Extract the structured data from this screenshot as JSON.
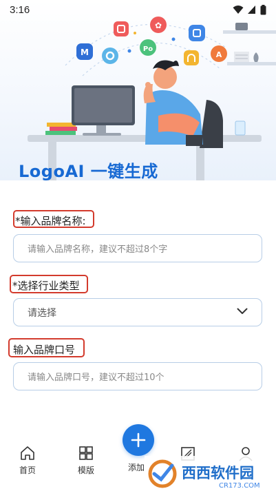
{
  "status_bar": {
    "time": "3:16"
  },
  "hero": {
    "title": "LogoAI  一键生成"
  },
  "form": {
    "brand_name": {
      "label": "*输入品牌名称:",
      "placeholder": "请输入品牌名称，建议不超过8个字"
    },
    "industry": {
      "label": "*选择行业类型",
      "selected": "请选择"
    },
    "slogan": {
      "label": "输入品牌口号",
      "placeholder": "请输入品牌口号，建议不超过10个"
    }
  },
  "bottom_nav": {
    "items": [
      {
        "label": "首页",
        "icon": "home-icon"
      },
      {
        "label": "模版",
        "icon": "grid-icon"
      },
      {
        "label": "添加",
        "icon": "plus-icon"
      },
      {
        "label": "",
        "icon": "image-icon"
      },
      {
        "label": "",
        "icon": "user-icon"
      }
    ]
  },
  "watermark": {
    "brand": "西西软件园",
    "url": "CR173.COM"
  },
  "colors": {
    "accent": "#1f78e0",
    "title": "#1769d3",
    "highlight_border": "#d33a2c",
    "input_border": "#b7cde6"
  }
}
